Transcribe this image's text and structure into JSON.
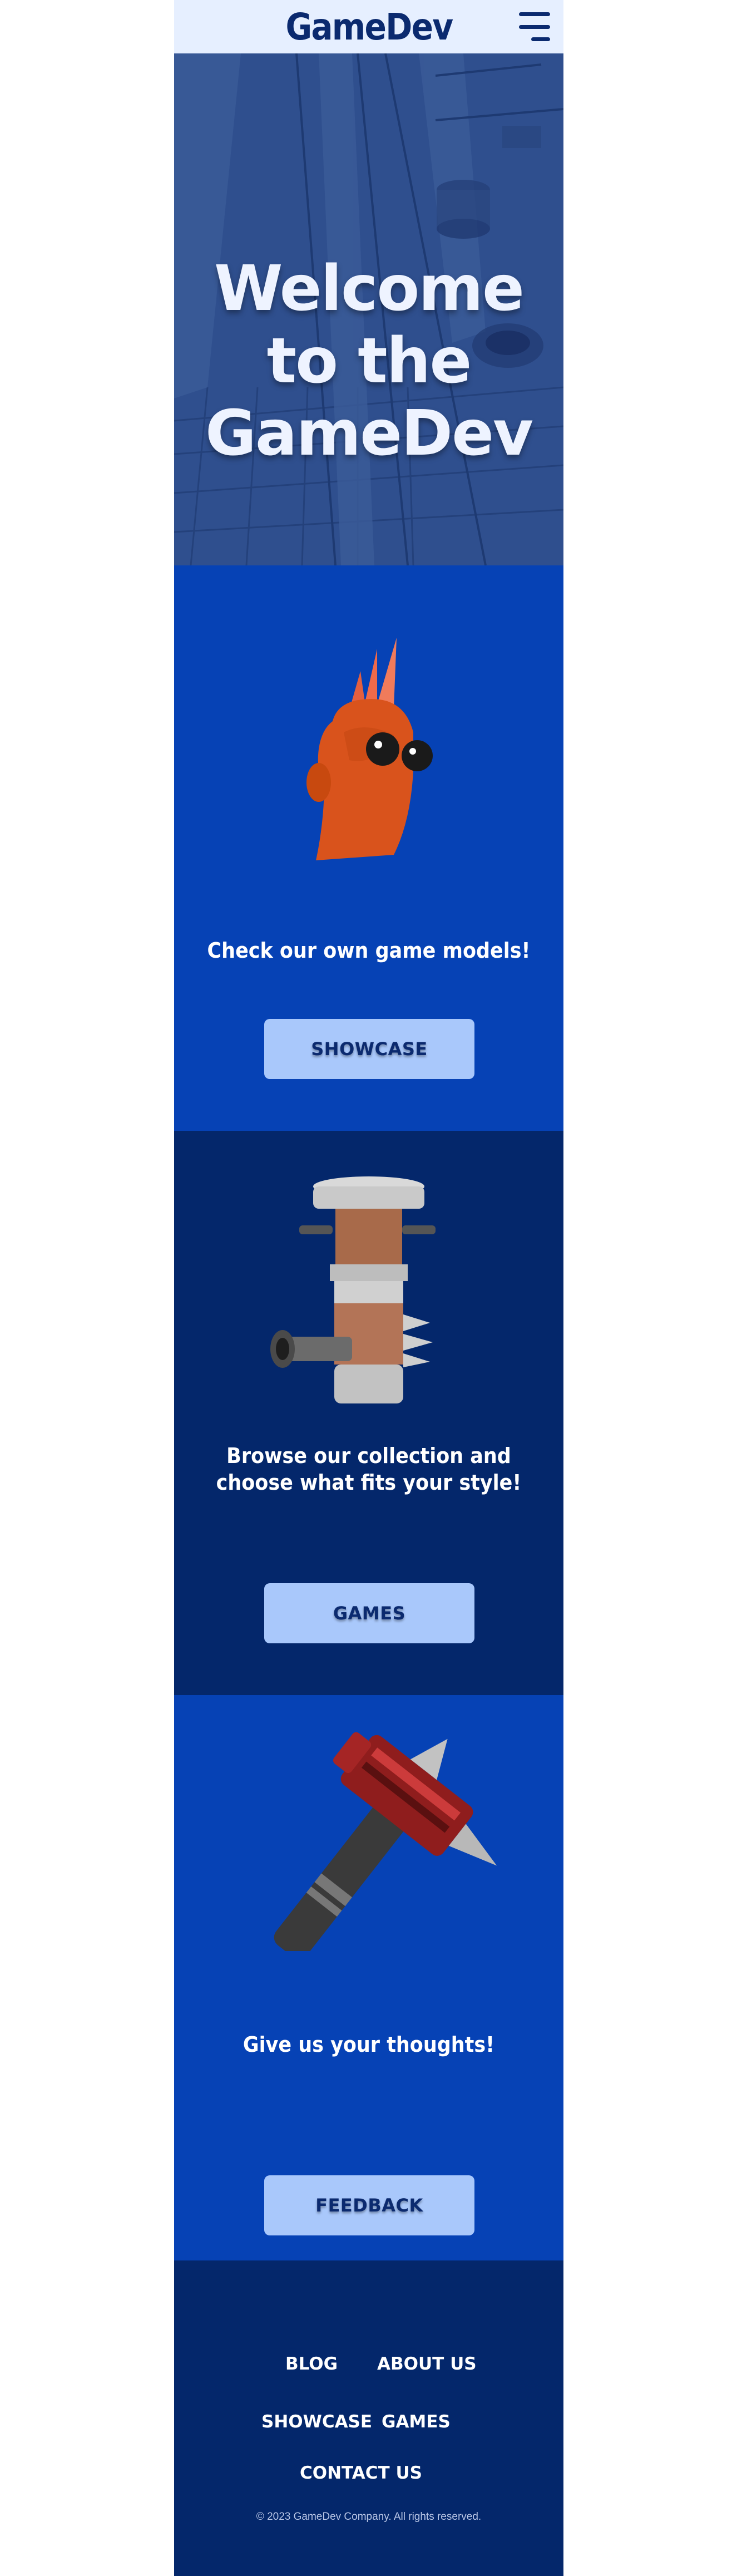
{
  "header": {
    "logo": "GameDev",
    "menu_icon": "hamburger-menu-icon"
  },
  "hero": {
    "title": "Welcome to the GameDev"
  },
  "sections": [
    {
      "text": "Check our own game models!",
      "button": "SHOWCASE",
      "image": "orange-creature-model"
    },
    {
      "text": "Browse our collection and choose what fits your style!",
      "button": "GAMES",
      "image": "cannon-tower-model"
    },
    {
      "text": "Give us your thoughts!",
      "button": "FEEDBACK",
      "image": "spiked-hammer-model"
    }
  ],
  "footer": {
    "links": {
      "blog": "BLOG",
      "about": "ABOUT US",
      "showcase": "SHOWCASE",
      "games": "GAMES",
      "contact": "CONTACT US"
    },
    "copyright": "© 2023 GameDev Company. All rights reserved."
  },
  "colors": {
    "header_bg": "#e6efff",
    "brand": "#0b2a6f",
    "primary": "#0642b5",
    "dark": "#04276b",
    "button": "#a9c8fb"
  }
}
